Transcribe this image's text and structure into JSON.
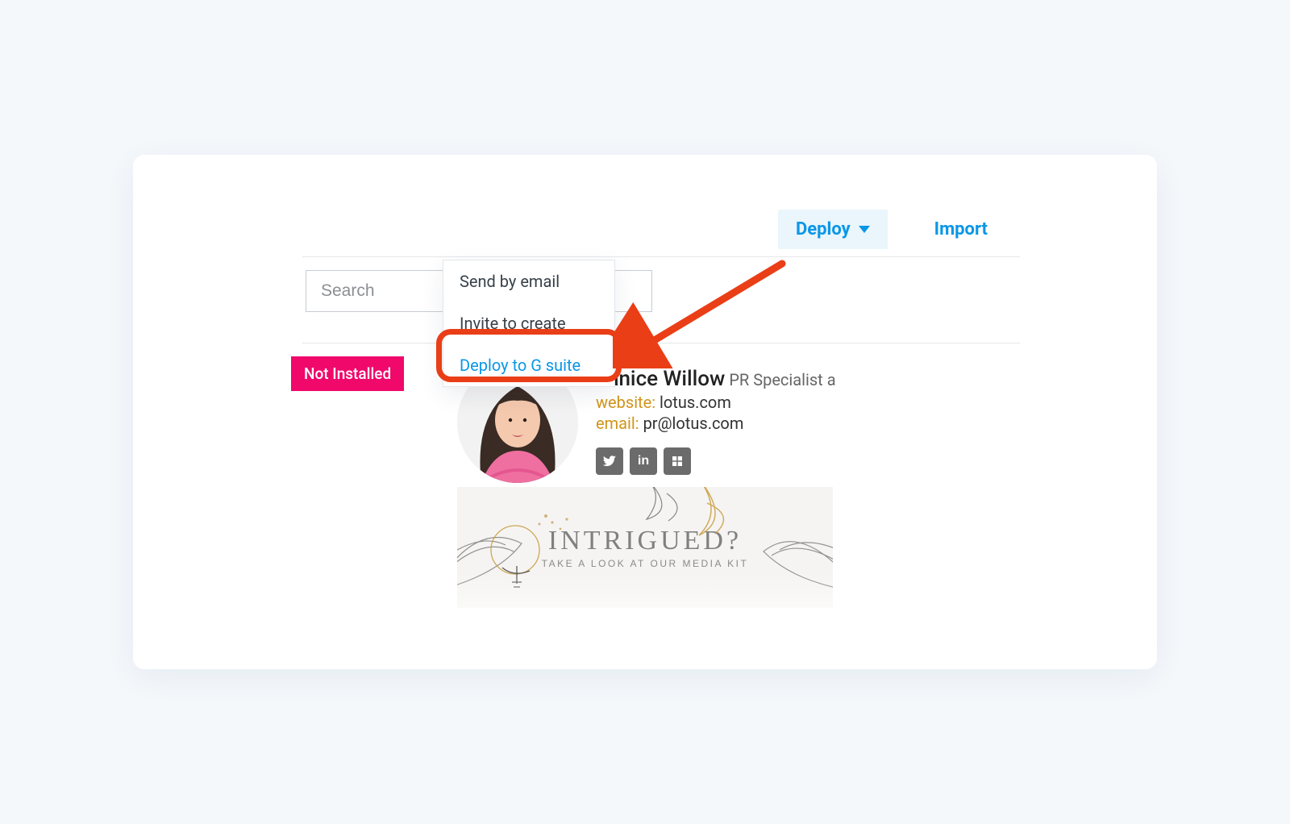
{
  "toolbar": {
    "deploy_label": "Deploy",
    "import_label": "Import"
  },
  "search": {
    "placeholder": "Search"
  },
  "dropdown": {
    "items": [
      {
        "label": "Send by email"
      },
      {
        "label": "Invite to create"
      },
      {
        "label": "Deploy to G suite"
      }
    ]
  },
  "status": {
    "not_installed_label": "Not Installed"
  },
  "signature": {
    "name": "Janice Willow",
    "title": "PR Specialist a",
    "website_key": "website:",
    "website_value": "lotus.com",
    "email_key": "email:",
    "email_value": "pr@lotus.com",
    "social": {
      "twitter": "twitter-icon",
      "linkedin": "linkedin-icon",
      "google": "google-icon"
    }
  },
  "banner": {
    "headline": "INTRIGUED?",
    "tagline": "TAKE A LOOK AT OUR MEDIA KIT"
  },
  "colors": {
    "accent": "#0a97e6",
    "highlight": "#ea3e17",
    "status_bg": "#f0086b"
  }
}
